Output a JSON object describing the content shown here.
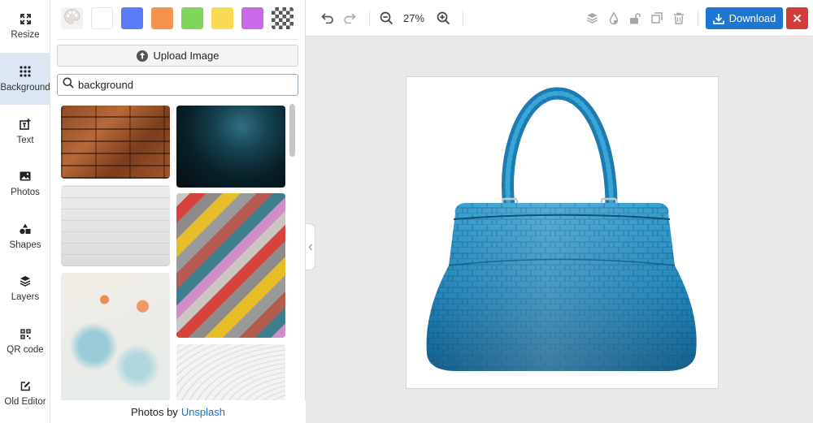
{
  "sidebar": {
    "items": [
      {
        "label": "Resize",
        "icon": "resize-icon",
        "active": false
      },
      {
        "label": "Background",
        "icon": "grid-dots-icon",
        "active": true
      },
      {
        "label": "Text",
        "icon": "add-text-icon",
        "active": false
      },
      {
        "label": "Photos",
        "icon": "image-icon",
        "active": false
      },
      {
        "label": "Shapes",
        "icon": "shapes-icon",
        "active": false
      },
      {
        "label": "Layers",
        "icon": "layers-icon",
        "active": false
      },
      {
        "label": "QR code",
        "icon": "qr-code-icon",
        "active": false
      },
      {
        "label": "Old Editor",
        "icon": "edit-icon",
        "active": false
      }
    ]
  },
  "panel": {
    "swatches": [
      "palette",
      "#ffffff",
      "#5b7cf7",
      "#f7924a",
      "#7fd65a",
      "#fcd952",
      "#c96be8",
      "transparent"
    ],
    "upload_label": "Upload Image",
    "search": {
      "value": "background",
      "placeholder": "background"
    },
    "credit_prefix": "Photos by",
    "credit_link": "Unsplash"
  },
  "toolbar": {
    "zoom": "27%",
    "download_label": "Download"
  },
  "colors": {
    "accent": "#1d76d2",
    "danger": "#d43b3b",
    "active_nav": "#dbe7f3"
  }
}
